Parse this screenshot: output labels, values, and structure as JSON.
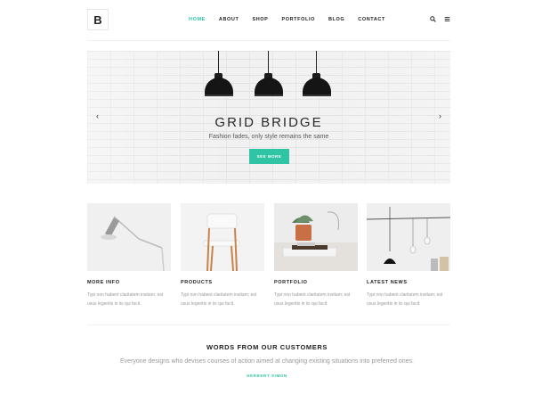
{
  "header": {
    "logo": "B",
    "nav": [
      "HOME",
      "ABOUT",
      "SHOP",
      "PORTFOLIO",
      "BLOG",
      "CONTACT"
    ],
    "active_nav": "HOME",
    "icons": [
      "search-icon",
      "menu-icon"
    ]
  },
  "hero": {
    "title": "GRID BRIDGE",
    "subtitle": "Fashion fades, only style remains the same",
    "button": "SEE MORE",
    "prev": "‹",
    "next": "›"
  },
  "cards": [
    {
      "title": "MORE INFO",
      "text": "Typi non habent claritatem insitam; est usus legentis in iis qui facit."
    },
    {
      "title": "PRODUCTS",
      "text": "Typi non habent claritatem insitam; est usus legentis in iis qui facit."
    },
    {
      "title": "PORTFOLIO",
      "text": "Typi non habent claritatem insitam; est usus legentis in iis qui facit."
    },
    {
      "title": "LATEST NEWS",
      "text": "Typi non habent claritatem insitam; est usus legentis in iis qui facit."
    }
  ],
  "testimonials": {
    "title": "WORDS FROM OUR CUSTOMERS",
    "quote": "Everyone designs who devises courses of action aimed at changing existing situations into preferred ones.",
    "author": "HERBERT SIMON"
  },
  "colors": {
    "accent": "#2ec4a4"
  }
}
